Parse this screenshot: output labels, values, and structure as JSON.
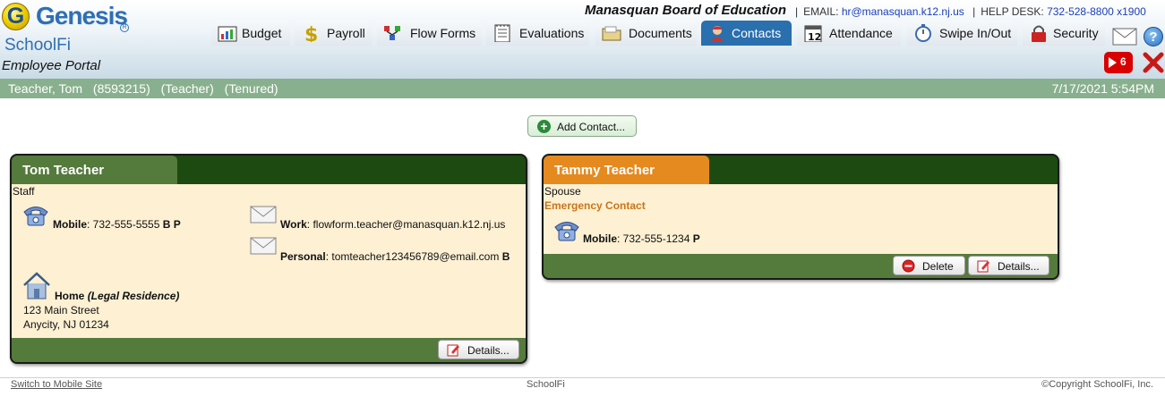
{
  "branding": {
    "logo_letter": "G",
    "logo_text": "Genesis",
    "registered_mark": "R",
    "product": "SchoolFi",
    "portal": "Employee Portal"
  },
  "header": {
    "district": "Manasquan Board of Education",
    "email_label": "EMAIL:",
    "email": "hr@manasquan.k12.nj.us",
    "helpdesk_label": "HELP DESK:",
    "helpdesk": "732-528-8800 x1900"
  },
  "tabs": [
    {
      "label": "Budget",
      "icon": "budget-chart-icon",
      "active": false
    },
    {
      "label": "Payroll",
      "icon": "dollar-icon",
      "active": false
    },
    {
      "label": "Flow Forms",
      "icon": "flow-forms-icon",
      "active": false
    },
    {
      "label": "Evaluations",
      "icon": "notepad-icon",
      "active": false
    },
    {
      "label": "Documents",
      "icon": "folder-icon",
      "active": false
    },
    {
      "label": "Contacts",
      "icon": "contacts-person-icon",
      "active": true
    },
    {
      "label": "Attendance",
      "icon": "calendar-icon",
      "active": false
    },
    {
      "label": "Swipe In/Out",
      "icon": "stopwatch-icon",
      "active": false
    },
    {
      "label": "Security",
      "icon": "padlock-icon",
      "active": false
    }
  ],
  "calendar_day": "12",
  "help_glyph": "?",
  "video_badge_count": "6",
  "status": {
    "name": "Teacher, Tom",
    "id": "(8593215)",
    "role": "(Teacher)",
    "tenure": "(Tenured)",
    "datetime": "7/17/2021 5:54PM"
  },
  "add_contact_label": "Add Contact...",
  "add_contact_glyph": "+",
  "contacts": [
    {
      "name": "Tom Teacher",
      "tab_color": "#547a3c",
      "relationship": "Staff",
      "phone_label": "Mobile",
      "phone_number": "732-555-5555",
      "phone_flags": "B P",
      "work_email_label": "Work",
      "work_email": "flowform.teacher@manasquan.k12.nj.us",
      "personal_email_label": "Personal",
      "personal_email": "tomteacher123456789@email.com",
      "personal_email_flag": "B",
      "address_label": "Home",
      "address_type": "(Legal Residence)",
      "address_line1": "123 Main Street",
      "address_line2": "Anycity, NJ 01234",
      "details_label": "Details..."
    },
    {
      "name": "Tammy Teacher",
      "tab_color": "#e58a1f",
      "relationship": "Spouse",
      "emergency": "Emergency Contact",
      "phone_label": "Mobile",
      "phone_number": "732-555-1234",
      "phone_flags": "P",
      "delete_label": "Delete",
      "details_label": "Details..."
    }
  ],
  "footer": {
    "mobile_link": "Switch to Mobile Site",
    "center": "SchoolFi",
    "copyright": "©Copyright SchoolFi, Inc."
  },
  "colors": {
    "status_bar": "#89b08e",
    "active_tab": "#2a6fae",
    "card_frame": "#1c4a11",
    "card_body": "#fdf0d3",
    "emergency_text": "#c8761a"
  }
}
